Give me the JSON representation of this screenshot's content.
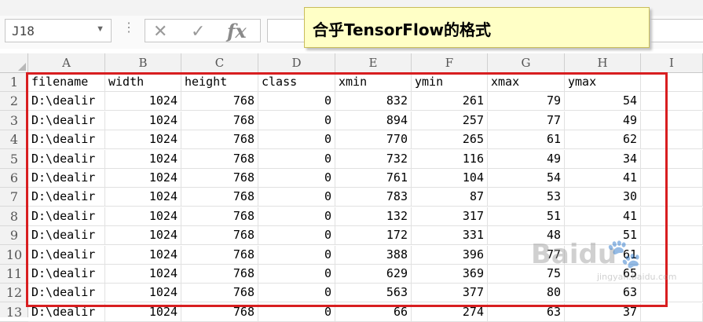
{
  "formula_bar": {
    "name_box": "J18",
    "name_box_arrow": "▼",
    "dots": "⋮",
    "cancel_icon": "✕",
    "enter_icon": "✓",
    "fx_label": "fx",
    "formula": ""
  },
  "callout": {
    "text": "合乎TensorFlow的格式"
  },
  "columns": [
    "A",
    "B",
    "C",
    "D",
    "E",
    "F",
    "G",
    "H",
    "I"
  ],
  "rows": [
    "1",
    "2",
    "3",
    "4",
    "5",
    "6",
    "7",
    "8",
    "9",
    "10",
    "11",
    "12",
    "13"
  ],
  "table": {
    "headers": [
      "filename",
      "width",
      "height",
      "class",
      "xmin",
      "ymin",
      "xmax",
      "ymax"
    ],
    "data": [
      [
        "D:\\dealir",
        "1024",
        "768",
        "0",
        "832",
        "261",
        "79",
        "54"
      ],
      [
        "D:\\dealir",
        "1024",
        "768",
        "0",
        "894",
        "257",
        "77",
        "49"
      ],
      [
        "D:\\dealir",
        "1024",
        "768",
        "0",
        "770",
        "265",
        "61",
        "62"
      ],
      [
        "D:\\dealir",
        "1024",
        "768",
        "0",
        "732",
        "116",
        "49",
        "34"
      ],
      [
        "D:\\dealir",
        "1024",
        "768",
        "0",
        "761",
        "104",
        "54",
        "41"
      ],
      [
        "D:\\dealir",
        "1024",
        "768",
        "0",
        "783",
        "87",
        "53",
        "30"
      ],
      [
        "D:\\dealir",
        "1024",
        "768",
        "0",
        "132",
        "317",
        "51",
        "41"
      ],
      [
        "D:\\dealir",
        "1024",
        "768",
        "0",
        "172",
        "331",
        "48",
        "51"
      ],
      [
        "D:\\dealir",
        "1024",
        "768",
        "0",
        "388",
        "396",
        "77",
        "61"
      ],
      [
        "D:\\dealir",
        "1024",
        "768",
        "0",
        "629",
        "369",
        "75",
        "65"
      ],
      [
        "D:\\dealir",
        "1024",
        "768",
        "0",
        "563",
        "377",
        "80",
        "63"
      ],
      [
        "D:\\dealir",
        "1024",
        "768",
        "0",
        "66",
        "274",
        "63",
        "37"
      ]
    ]
  },
  "watermark": {
    "main": "Baidu",
    "sub": "jingyan.baidu.com",
    "paw": "🐾"
  },
  "colors": {
    "highlight_border": "#d81e20",
    "callout_bg": "#ffffc6"
  }
}
